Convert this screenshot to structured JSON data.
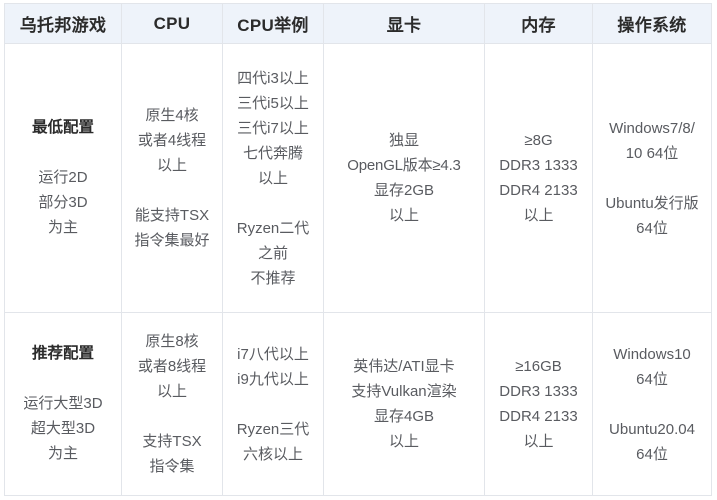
{
  "table": {
    "headers": [
      {
        "label": "乌托邦游戏",
        "name": "header-product"
      },
      {
        "label": "CPU",
        "name": "header-cpu"
      },
      {
        "label": "CPU举例",
        "name": "header-cpu-examples"
      },
      {
        "label": "显卡",
        "name": "header-gpu"
      },
      {
        "label": "内存",
        "name": "header-memory"
      },
      {
        "label": "操作系统",
        "name": "header-os"
      }
    ],
    "rows": [
      {
        "key": "minimum",
        "tier": {
          "title": "最低配置",
          "sub": [
            "运行2D",
            "部分3D",
            "为主"
          ]
        },
        "cpu": {
          "group1": [
            "原生4核",
            "或者4线程",
            "以上"
          ],
          "group2": [
            "能支持TSX",
            "指令集最好"
          ]
        },
        "cpu_examples": {
          "group1": [
            "四代i3以上",
            "三代i5以上",
            "三代i7以上",
            "七代奔腾",
            "以上"
          ],
          "group2": [
            "Ryzen二代",
            "之前",
            "不推荐"
          ]
        },
        "gpu": {
          "group1": [
            "独显",
            "OpenGL版本≥4.3",
            "显存2GB",
            "以上"
          ],
          "group2": []
        },
        "memory": {
          "group1": [
            "≥8G",
            "DDR3 1333",
            "DDR4 2133",
            "以上"
          ],
          "group2": []
        },
        "os": {
          "group1": [
            "Windows7/8/",
            "10 64位"
          ],
          "group2": [
            "Ubuntu发行版",
            "64位"
          ]
        }
      },
      {
        "key": "recommended",
        "tier": {
          "title": "推荐配置",
          "sub": [
            "运行大型3D",
            "超大型3D",
            "为主"
          ]
        },
        "cpu": {
          "group1": [
            "原生8核",
            "或者8线程",
            "以上"
          ],
          "group2": [
            "支持TSX",
            "指令集"
          ]
        },
        "cpu_examples": {
          "group1": [
            "i7八代以上",
            "i9九代以上"
          ],
          "group2": [
            "Ryzen三代",
            "六核以上"
          ]
        },
        "gpu": {
          "group1": [
            "英伟达/ATI显卡",
            "支持Vulkan渲染",
            "显存4GB",
            "以上"
          ],
          "group2": []
        },
        "memory": {
          "group1": [
            "≥16GB",
            "DDR3 1333",
            "DDR4 2133",
            "以上"
          ],
          "group2": []
        },
        "os": {
          "group1": [
            "Windows10",
            "64位"
          ],
          "group2": [
            "Ubuntu20.04",
            "64位"
          ]
        }
      }
    ]
  },
  "colors": {
    "header_background": "#eef3fa",
    "border": "#e2e5ea",
    "title_text": "#2b2b2b",
    "body_text": "#595b60",
    "page_background": "#ffffff"
  }
}
